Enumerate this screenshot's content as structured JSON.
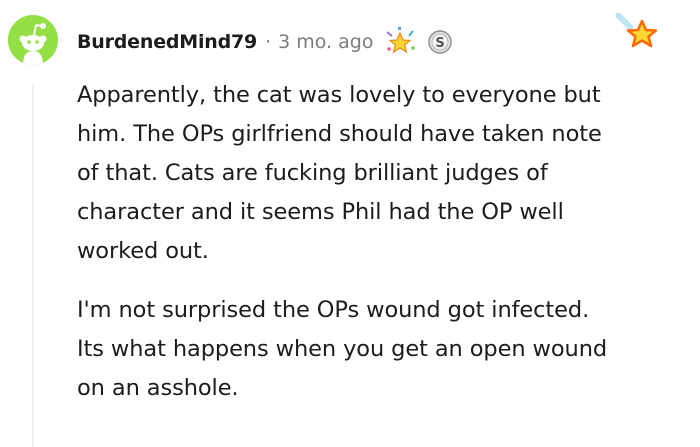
{
  "comment": {
    "username": "BurdenedMind79",
    "separator": "·",
    "timestamp": "3 mo. ago",
    "avatar_icon": "snoo-avatar-icon",
    "avatar_color": "#94e044",
    "awards": [
      "confetti-star-award-icon",
      "silver-coin-award-icon"
    ],
    "side_award": "rising-star-award-icon",
    "paragraphs": [
      {
        "lines": [
          "Apparently, the cat was lovely to everyone but",
          "him. The OPs girlfriend should have taken note",
          "of that. Cats are fucking brilliant judges of",
          "character and it seems Phil had the OP well",
          "worked out."
        ]
      },
      {
        "lines": [
          "I'm not surprised the OPs wound got infected.",
          "Its what happens when you get an open wound",
          "on an asshole."
        ]
      }
    ]
  }
}
